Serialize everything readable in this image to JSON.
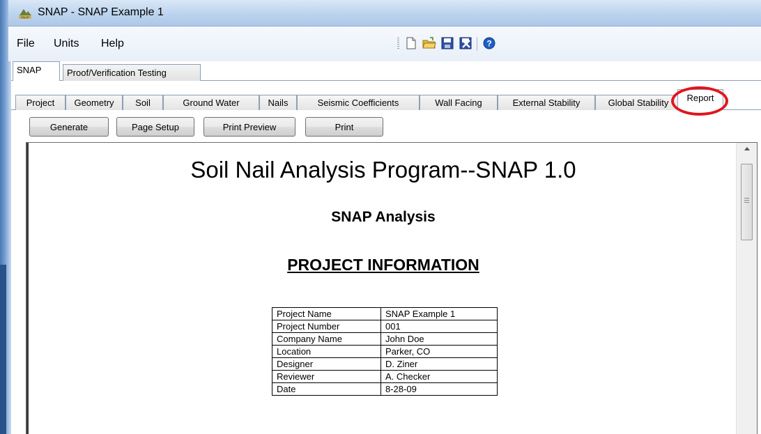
{
  "window": {
    "title": "SNAP - SNAP Example 1",
    "app_icon_text": "SNAP"
  },
  "menu": {
    "items": [
      "File",
      "Units",
      "Help"
    ]
  },
  "toolbar": {
    "icons": [
      "new-document-icon",
      "open-folder-icon",
      "save-icon",
      "export-icon",
      "help-icon"
    ]
  },
  "outer_tabs": [
    {
      "label": "SNAP",
      "active": true
    },
    {
      "label": "Proof/Verification Testing",
      "active": false
    }
  ],
  "inner_tabs": [
    {
      "label": "Project",
      "active": false
    },
    {
      "label": "Geometry",
      "active": false
    },
    {
      "label": "Soil",
      "active": false
    },
    {
      "label": "Ground Water",
      "active": false
    },
    {
      "label": "Nails",
      "active": false
    },
    {
      "label": "Seismic Coefficients",
      "active": false
    },
    {
      "label": "Wall Facing",
      "active": false
    },
    {
      "label": "External Stability",
      "active": false
    },
    {
      "label": "Global Stability",
      "active": false
    },
    {
      "label": "Report",
      "active": true
    }
  ],
  "buttons": {
    "generate": "Generate",
    "page_setup": "Page Setup",
    "print_preview": "Print Preview",
    "print": "Print"
  },
  "report": {
    "title": "Soil Nail Analysis Program--SNAP 1.0",
    "subtitle": "SNAP Analysis",
    "section": "PROJECT INFORMATION",
    "project_info": [
      [
        "Project Name",
        "SNAP Example 1"
      ],
      [
        "Project Number",
        "001"
      ],
      [
        "Company Name",
        "John Doe"
      ],
      [
        "Location",
        "Parker, CO"
      ],
      [
        "Designer",
        "D. Ziner"
      ],
      [
        "Reviewer",
        "A. Checker"
      ],
      [
        "Date",
        "8-28-09"
      ]
    ]
  },
  "colors": {
    "highlight_circle": "#e0161e",
    "title_bar": "#bcd3ee"
  }
}
